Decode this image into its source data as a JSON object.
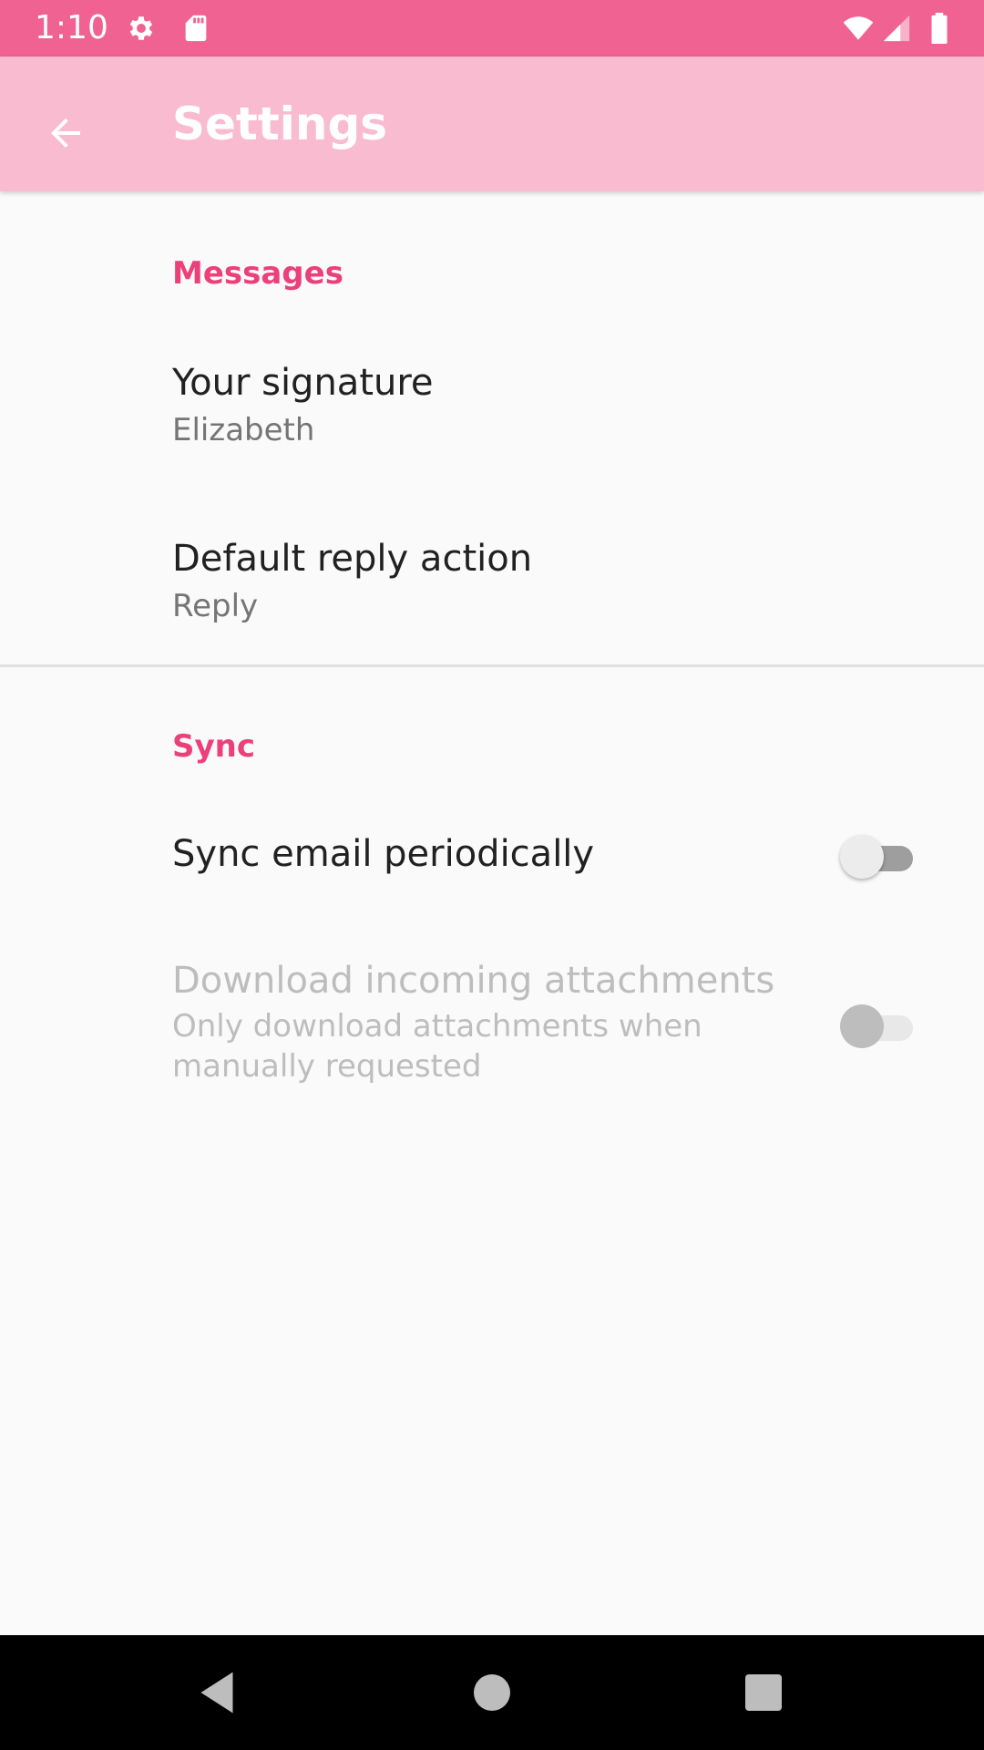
{
  "status_bar": {
    "time": "1:10",
    "color": "#f06292",
    "icons": [
      "gear-icon",
      "sd-card-icon",
      "wifi-icon",
      "signal-icon",
      "battery-icon"
    ]
  },
  "app_bar": {
    "title": "Settings",
    "back_icon": "arrow-back-icon",
    "color": "#f8bbd0"
  },
  "sections": [
    {
      "header": "Messages",
      "items": [
        {
          "title": "Your signature",
          "summary": "Elizabeth"
        },
        {
          "title": "Default reply action",
          "summary": "Reply"
        }
      ]
    },
    {
      "header": "Sync",
      "items": [
        {
          "title": "Sync email periodically",
          "summary": "",
          "switch_on": false,
          "enabled": true
        },
        {
          "title": "Download incoming attachments",
          "summary": "Only download attachments when manually requested",
          "switch_on": false,
          "enabled": false
        }
      ]
    }
  ],
  "accent_color": "#ec407a",
  "nav_bar": {
    "icons": [
      "back-triangle-icon",
      "home-circle-icon",
      "recents-square-icon"
    ]
  }
}
